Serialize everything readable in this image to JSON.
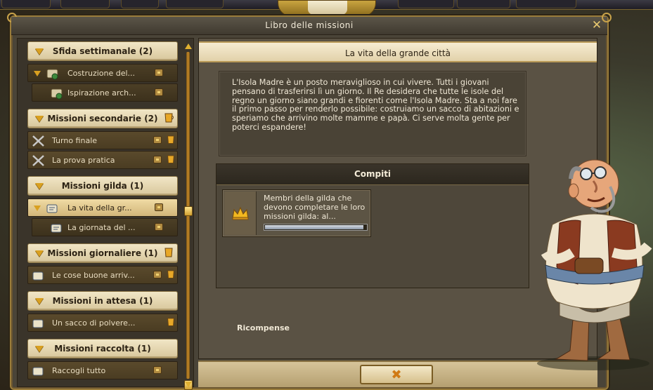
{
  "window": {
    "title": "Libro delle missioni"
  },
  "sections": [
    {
      "label": "Sfida settimanale (2)",
      "items": [
        "Costruzione del...",
        "Ispirazione arch..."
      ]
    },
    {
      "label": "Missioni secondarie (2)",
      "items": [
        "Turno finale",
        "La prova pratica"
      ]
    },
    {
      "label": "Missioni gilda (1)",
      "items": [
        "La vita della gr...",
        "La giornata del ..."
      ]
    },
    {
      "label": "Missioni giornaliere (1)",
      "items": [
        "Le cose buone arriv..."
      ]
    },
    {
      "label": "Missioni in attesa (1)",
      "items": [
        "Un sacco di polvere..."
      ]
    },
    {
      "label": "Missioni raccolta (1)",
      "items": [
        "Raccogli tutto"
      ]
    }
  ],
  "quest": {
    "title": "La vita della grande città",
    "description": "L'Isola Madre è un posto meraviglioso in cui vivere. Tutti i giovani pensano di trasferirsi lì un giorno. Il Re desidera che tutte le isole del regno un giorno siano grandi e fiorenti come l'Isola Madre. Sta a noi fare il primo passo per renderlo possibile: costruiamo un sacco di abitazioni e speriamo che arrivino molte mamme e papà. Ci serve molta gente per poterci espandere!",
    "tasks_title": "Compiti",
    "task": {
      "text": "Membri della gilda che devono completare le loro missioni gilda: al...",
      "progress": 0.97
    },
    "rewards_label": "Ricompense"
  },
  "icons": {
    "close": "close-icon",
    "ok": "confirm-x-icon",
    "task": "crown-icon",
    "weekly": "scroll-map-icon",
    "side": "crossed-swords-icon",
    "guild": "scroll-pen-icon",
    "reward": "chest-icon",
    "cup": "cup-icon"
  },
  "colors": {
    "accent": "#d9a020",
    "header": "#e8d8b0",
    "panel": "#5a5244"
  }
}
